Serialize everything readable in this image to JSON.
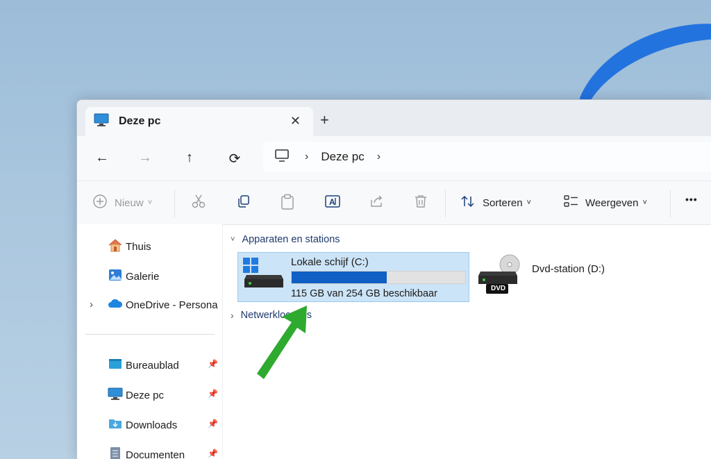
{
  "window": {
    "tab_title": "Deze pc",
    "tab_close": "✕",
    "new_tab": "+"
  },
  "navigation": {
    "back": "←",
    "forward": "→",
    "up": "↑",
    "refresh": "⟳",
    "breadcrumb_item": "Deze pc",
    "separator": "›"
  },
  "toolbar": {
    "new_label": "Nieuw",
    "sort_label": "Sorteren",
    "view_label": "Weergeven",
    "more_label": "•••",
    "dropdown_caret": "˅"
  },
  "sidebar": {
    "items": [
      {
        "label": "Thuis",
        "icon": "home-icon"
      },
      {
        "label": "Galerie",
        "icon": "gallery-icon"
      },
      {
        "label": "OneDrive - Persona",
        "icon": "onedrive-icon"
      },
      {
        "label": "Bureaublad",
        "icon": "desktop-folder-icon",
        "pinned": true
      },
      {
        "label": "Deze pc",
        "icon": "monitor-icon",
        "pinned": true
      },
      {
        "label": "Downloads",
        "icon": "downloads-folder-icon",
        "pinned": true
      },
      {
        "label": "Documenten",
        "icon": "documents-icon",
        "pinned": true
      }
    ],
    "expand_caret": "›"
  },
  "content": {
    "group_devices": "Apparaten en stations",
    "group_network": "Netwerklocaties",
    "group_caret_open": "˅",
    "group_caret_closed": "›",
    "drive_c": {
      "name": "Lokale schijf (C:)",
      "free_text": "115 GB van 254 GB beschikbaar",
      "used_fraction": 0.547
    },
    "drive_d": {
      "name": "Dvd-station (D:)",
      "badge": "DVD"
    }
  },
  "colors": {
    "accent": "#0f5fc4",
    "selection": "#cce4f7",
    "arrow": "#2eaa2e"
  }
}
